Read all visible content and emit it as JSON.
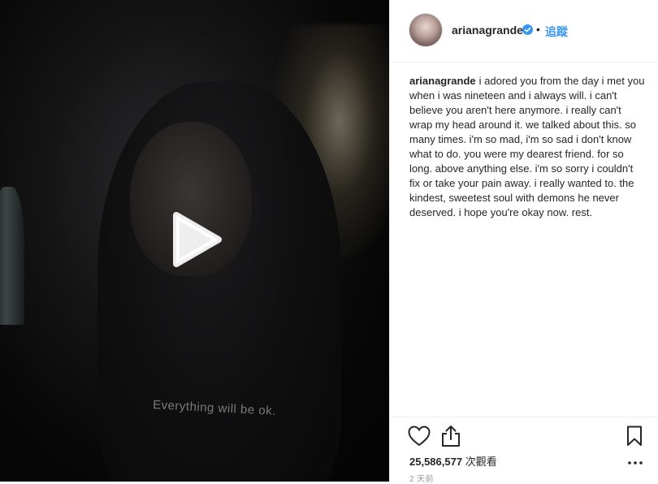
{
  "post": {
    "media": {
      "overlay_text": "Everything will be ok.",
      "play_icon": "play-icon"
    },
    "header": {
      "username": "arianagrande",
      "verified_icon": "verified-badge-icon",
      "separator": "•",
      "follow_label": "追蹤"
    },
    "caption": {
      "username": "arianagrande",
      "text": "i adored you from the day i met you when i was nineteen and i always will. i can't believe you aren't here anymore. i really can't wrap my head around it. we talked about this. so many times. i'm so mad, i'm so sad i don't know what to do. you were my dearest friend. for so long. above anything else. i'm so sorry i couldn't fix or take your pain away. i really wanted to. the kindest, sweetest soul with demons he never deserved. i hope you're okay now. rest."
    },
    "actions": {
      "like_icon": "heart-icon",
      "share_icon": "share-icon",
      "save_icon": "bookmark-icon",
      "more_icon": "more-options-icon"
    },
    "stats": {
      "view_count": "25,586,577",
      "view_label": "次觀看",
      "timestamp": "2 天前"
    },
    "colors": {
      "link_blue": "#3897f0",
      "text_dark": "#262626",
      "text_muted": "#999999",
      "border": "#efefef",
      "verified_blue": "#3897f0"
    }
  }
}
